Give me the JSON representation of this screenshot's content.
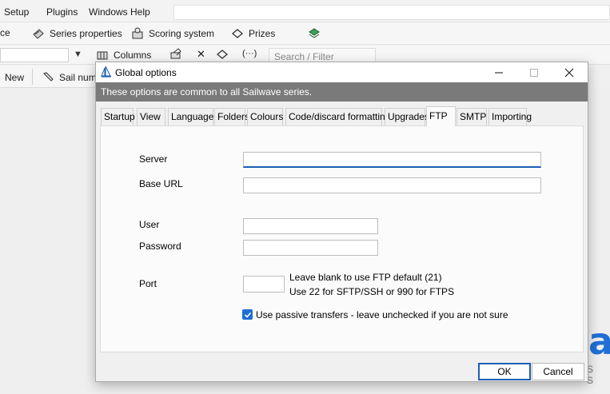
{
  "app": {
    "menu": [
      "Setup",
      "Plugins",
      "Windows Help"
    ],
    "toolbar1": {
      "left_fragment": "ce",
      "series_properties": "Series properties",
      "scoring_system": "Scoring system",
      "prizes": "Prizes"
    },
    "toolbar2": {
      "columns": "Columns",
      "search_placeholder": "Search / Filter"
    },
    "toolbar3": {
      "new": "New",
      "sail_number": "Sail num"
    },
    "logo_fragment": "a",
    "logo_sub": "S S"
  },
  "dialog": {
    "title": "Global options",
    "info": "These options are common to all Sailwave series.",
    "tabs": [
      "Startup",
      "View",
      "Language",
      "Folders",
      "Colours",
      "Code/discard formatting",
      "Upgrades",
      "FTP",
      "SMTP",
      "Importing"
    ],
    "active_tab": "FTP",
    "fields": {
      "server": {
        "label": "Server",
        "value": ""
      },
      "base_url": {
        "label": "Base URL",
        "value": ""
      },
      "user": {
        "label": "User",
        "value": ""
      },
      "password": {
        "label": "Password",
        "value": ""
      },
      "port": {
        "label": "Port",
        "value": ""
      }
    },
    "port_hint_1": "Leave blank to use FTP default (21)",
    "port_hint_2": "Use 22  for SFTP/SSH or 990 for FTPS",
    "passive_checkbox": {
      "label": "Use passive transfers - leave unchecked if you are not sure",
      "checked": true
    },
    "ok_label": "OK",
    "cancel_label": "Cancel"
  },
  "colors": {
    "accent": "#1a5fb4",
    "info_bar": "#7a7a7a",
    "checkbox": "#1f6ed4",
    "logo": "#1f6fd6"
  },
  "icons": [
    "series-properties-icon",
    "scoring-system-icon",
    "prizes-icon",
    "layers-icon",
    "columns-icon",
    "edit-icon",
    "close-x-icon",
    "filter-icon",
    "code-icon",
    "sail-icon",
    "dialog-app-icon",
    "minimize-icon",
    "maximize-icon",
    "close-icon",
    "checkmark-icon",
    "dropdown-arrow-icon"
  ]
}
